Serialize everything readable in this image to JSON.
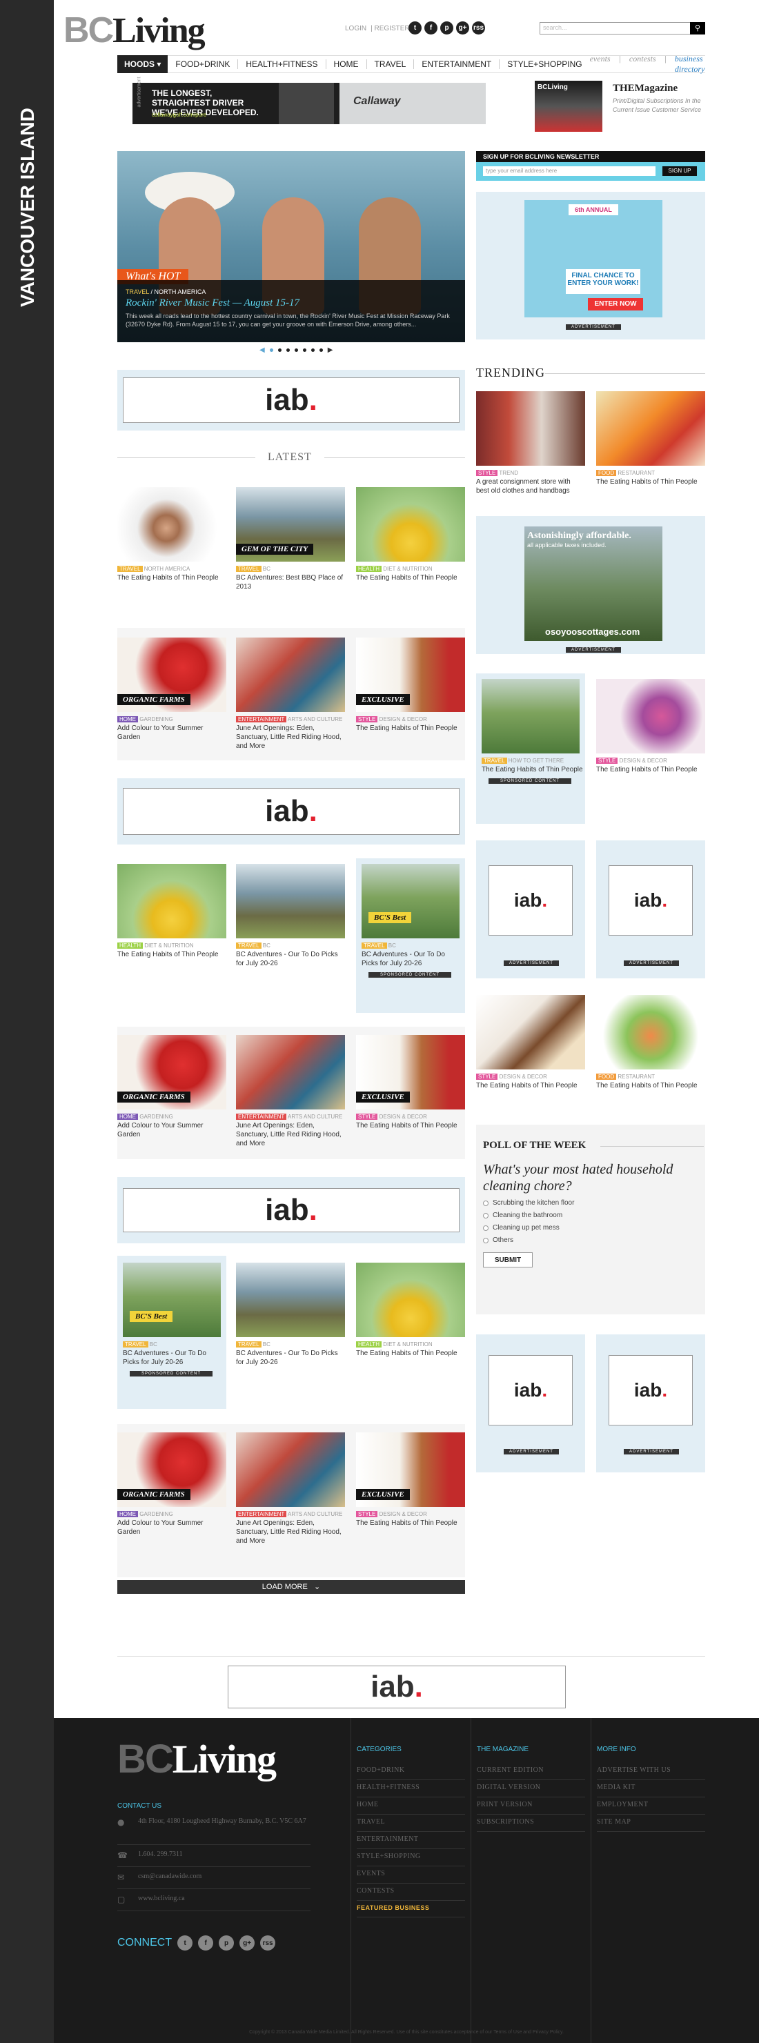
{
  "side_label": "VANCOUVER ISLAND",
  "header": {
    "logo_bc": "BC",
    "logo_living": "Living",
    "login": "LOGIN",
    "register": "REGISTER",
    "search_placeholder": "search...",
    "search_icon": "magnifier-icon",
    "social": [
      "t",
      "f",
      "p",
      "g+",
      "rss"
    ]
  },
  "nav": {
    "hoods": "HOODS",
    "items": [
      "FOOD+DRINK",
      "HEALTH+FITNESS",
      "HOME",
      "TRAVEL",
      "ENTERTAINMENT",
      "STYLE+SHOPPING"
    ],
    "right": [
      "events",
      "contests",
      "business directory"
    ]
  },
  "top_ad": {
    "side": "advertisement",
    "text": "THE LONGEST, STRAIGHTEST DRIVER WE'VE EVER DEVELOPED.",
    "link": "callawaygolf.com/pure",
    "brand": "Callaway"
  },
  "magazine": {
    "cover": "BCLiving",
    "title": "THEMagazine",
    "desc": "Print/Digital Subscriptions In the Current Issue Customer Service"
  },
  "hero": {
    "badge": "What's HOT",
    "cat_primary": "TRAVEL",
    "cat_secondary": "NORTH AMERICA",
    "title": "Rockin' River Music Fest — August 15-17",
    "text": "This week all roads lead to the hottest country carnival in town, the Rockin' River Music Fest at Mission Raceway Park (32670 Dyke Rd). From August 15 to 17, you can get your groove on with Emerson Drive, among others..."
  },
  "newsletter": {
    "heading": "SIGN UP FOR BCLIVING NEWSLETTER",
    "placeholder": "type your email address here",
    "button": "SIGN UP"
  },
  "contest_ad": {
    "annual": "6th ANNUAL",
    "final": "FINAL CHANCE TO ENTER YOUR WORK!",
    "enter": "ENTER NOW"
  },
  "advertisement_label": "ADVERTISEMENT",
  "sponsored_label": "SPONSORED CONTENT",
  "iab": {
    "text": "iab",
    "dot": "."
  },
  "latest": "LATEST",
  "trending": "TRENDING",
  "trend_cards": [
    {
      "cat": "STYLE",
      "sub": "TREND",
      "title": "A great consignment store with best old clothes and handbags"
    },
    {
      "cat": "FOOD",
      "sub": "RESTAURANT",
      "title": "The Eating Habits of Thin People"
    }
  ],
  "cottage_ad": {
    "headline": "Astonishingly affordable.",
    "sub": "all applicable taxes included.",
    "url": "osoyooscottages.com"
  },
  "sponsor_cards": [
    {
      "cat": "TRAVEL",
      "sub": "HOW TO GET THERE",
      "title": "The Eating Habits of Thin People"
    },
    {
      "cat": "STYLE",
      "sub": "DESIGN & DECOR",
      "title": "The Eating Habits of Thin People"
    }
  ],
  "side_cards_2": [
    {
      "cat": "STYLE",
      "sub": "DESIGN & DECOR",
      "title": "The Eating Habits of Thin People"
    },
    {
      "cat": "FOOD",
      "sub": "RESTAURANT",
      "title": "The Eating Habits of Thin People"
    }
  ],
  "cards": {
    "r1": [
      {
        "cat": "TRAVEL",
        "sub": "NORTH AMERICA",
        "title": "The Eating Habits of Thin People"
      },
      {
        "cat": "TRAVEL",
        "sub": "BC",
        "title": "BC Adventures: Best BBQ Place of 2013",
        "ribbon": "GEM OF THE CITY"
      },
      {
        "cat": "HEALTH",
        "sub": "DIET & NUTRITION",
        "title": "The Eating Habits of Thin People"
      }
    ],
    "r2": [
      {
        "cat": "HOME",
        "sub": "GARDENING",
        "title": "Add Colour to Your Summer Garden",
        "ribbon": "ORGANIC FARMS"
      },
      {
        "cat": "ENTERTAINMENT",
        "sub": "ARTS AND CULTURE",
        "title": "June Art Openings: Eden, Sanctuary, Little Red Riding Hood, and More"
      },
      {
        "cat": "STYLE",
        "sub": "DESIGN & DECOR",
        "title": "The Eating Habits of Thin People",
        "ribbon": "EXCLUSIVE"
      }
    ],
    "r3": [
      {
        "cat": "HEALTH",
        "sub": "DIET & NUTRITION",
        "title": "The Eating Habits of Thin People"
      },
      {
        "cat": "TRAVEL",
        "sub": "BC",
        "title": "BC Adventures - Our To Do Picks for July 20-26"
      },
      {
        "cat": "TRAVEL",
        "sub": "BC",
        "title": "BC Adventures - Our To Do Picks for July 20-26",
        "ribbon": "BC'S Best"
      }
    ],
    "r5": [
      {
        "cat": "TRAVEL",
        "sub": "BC",
        "title": "BC Adventures - Our To Do Picks for July 20-26",
        "ribbon": "BC'S Best"
      },
      {
        "cat": "TRAVEL",
        "sub": "BC",
        "title": "BC Adventures - Our To Do Picks for July 20-26"
      },
      {
        "cat": "HEALTH",
        "sub": "DIET & NUTRITION",
        "title": "The Eating Habits of Thin People"
      }
    ]
  },
  "poll": {
    "heading": "POLL OF THE WEEK",
    "question": "What's your most hated household cleaning chore?",
    "options": [
      "Scrubbing the kitchen floor",
      "Cleaning the bathroom",
      "Cleaning up pet mess",
      "Others"
    ],
    "submit": "SUBMIT"
  },
  "load_more": "LOAD MORE",
  "footer": {
    "logo_bc": "BC",
    "logo_living": "Living",
    "contact_heading": "CONTACT US",
    "address": "4th Floor, 4180 Lougheed Highway Burnaby, B.C. V5C 6A7",
    "phone": "1.604. 299.7311",
    "email": "csm@canadawide.com",
    "web": "www.bcliving.ca",
    "connect": "CONNECT",
    "col1": {
      "heading": "CATEGORIES",
      "items": [
        "FOOD+DRINK",
        "HEALTH+FITNESS",
        "HOME",
        "TRAVEL",
        "ENTERTAINMENT",
        "STYLE+SHOPPING",
        "EVENTS",
        "CONTESTS"
      ],
      "featured": "FEATURED BUSINESS"
    },
    "col2": {
      "heading": "THE MAGAZINE",
      "items": [
        "CURRENT EDITION",
        "DIGITAL VERSION",
        "PRINT VERSION",
        "SUBSCRIPTIONS"
      ]
    },
    "col3": {
      "heading": "MORE INFO",
      "items": [
        "ADVERTISE WITH US",
        "MEDIA KIT",
        "EMPLOYMENT",
        "SITE MAP"
      ]
    },
    "copyright": "Copyright © 2013 Canada Wide Media Limited. All Rights Reserved. Use of this site constitutes acceptance of our Terms of Use and Privacy Policy."
  }
}
